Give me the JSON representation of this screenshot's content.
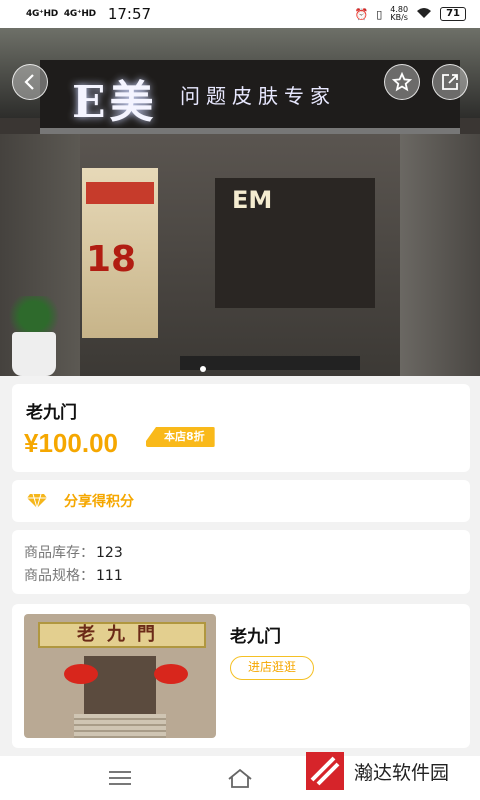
{
  "statusbar": {
    "network1": "4G⁺HD",
    "network2": "4G⁺HD",
    "time": "17:57",
    "speed_value": "4.80",
    "speed_unit": "KB/s",
    "battery": "71"
  },
  "hero": {
    "sign_main": "E美",
    "sign_sub": "问题皮肤专家",
    "back_sign": "EM",
    "poster_price": "18"
  },
  "product": {
    "name": "老九门",
    "price": "¥100.00",
    "discount_badge": "本店8折"
  },
  "share": {
    "label": "分享得积分",
    "icon": "diamond-icon"
  },
  "info": {
    "stock_label": "商品库存：",
    "stock_value": "123",
    "spec_label": "商品规格：",
    "spec_value": "111"
  },
  "shop": {
    "name": "老九门",
    "sign_text": "老九門",
    "visit_label": "进店逛逛"
  },
  "watermark": {
    "text": "瀚达软件园"
  },
  "colors": {
    "accent": "#f5a700",
    "badge": "#f9b91a"
  }
}
